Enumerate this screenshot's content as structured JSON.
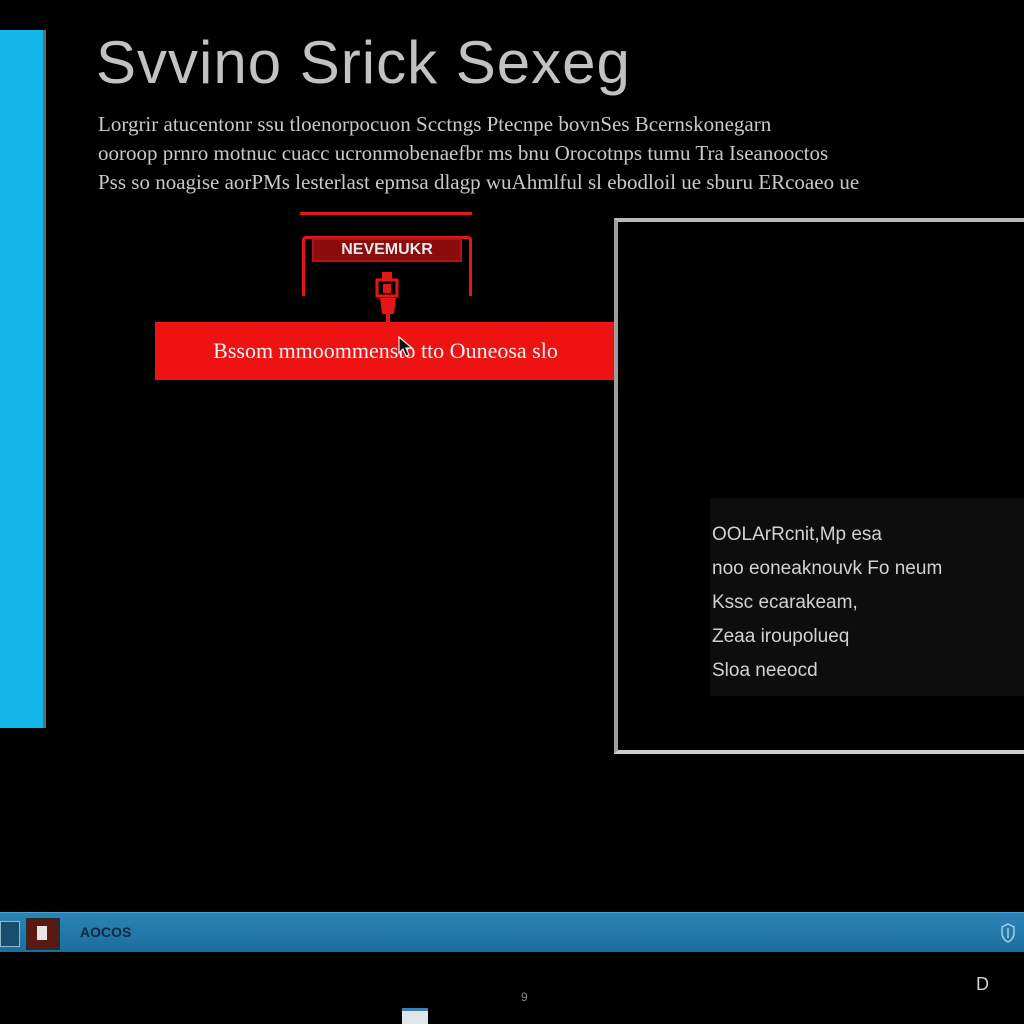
{
  "colors": {
    "background": "#000000",
    "left_panel": "#13b6e8",
    "accent_red": "#ef1212",
    "taskbar": "#1d6d9c"
  },
  "header": {
    "title": "Svvino Srick Sexeg"
  },
  "intro": {
    "lines": [
      "Lorgrir atucentonr ssu tloenorpocuon Scctngs Ptecnpe bovnSes Bcernskonegarn",
      "ooroop prnro motnuc cuacc ucronmobenaefbr ms bnu Orocotnps tumu Tra Iseanooctos",
      "Pss so noagise aorPMs lesterlast epmsa dlagp wuAhmlful sl ebodloil ue sburu ERcoaeo ue"
    ]
  },
  "panel": {
    "badge_label": "NEVEMUKR",
    "flag_icon": "flag-icon"
  },
  "main": {
    "action_button_label": "Bssom mmoommensto tto Ouneosa slo",
    "cursor_icon": "cursor-icon"
  },
  "dialog": {
    "info_lines": [
      "OOLArRcnit,Mp esa",
      "noo eoneaknouvk Fo neum",
      "Kssc ecarakeam,",
      "Zeaa iroupolueq",
      "Sloa neeocd"
    ]
  },
  "taskbar": {
    "label": "AOCOS",
    "tray_icon": "shield-icon"
  },
  "footer": {
    "small_text": "9",
    "corner_text": "D",
    "window_icon": "window-icon"
  }
}
